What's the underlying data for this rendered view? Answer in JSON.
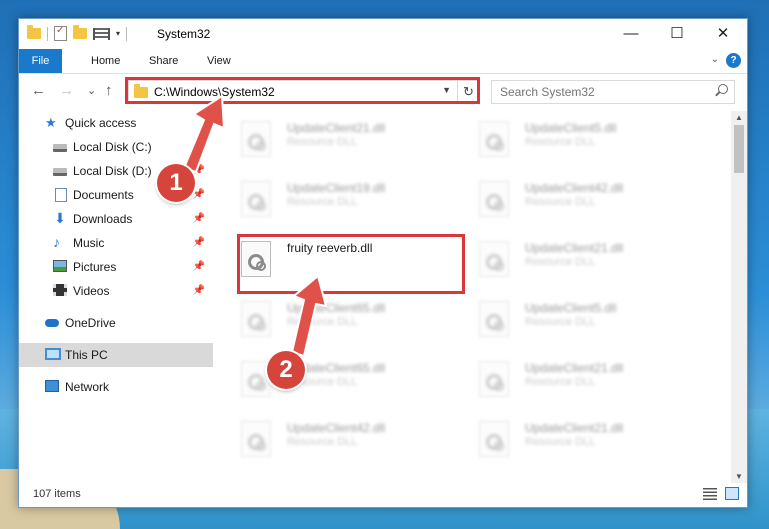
{
  "window": {
    "title": "System32",
    "controls": {
      "minimize": "—",
      "maximize": "☐",
      "close": "✕"
    }
  },
  "ribbon": {
    "tabs": [
      "File",
      "Home",
      "Share",
      "View"
    ],
    "help": "?"
  },
  "address_bar": {
    "path": "C:\\Windows\\System32",
    "refresh": "↻"
  },
  "search": {
    "placeholder": "Search System32"
  },
  "nav": {
    "back": "←",
    "forward": "→",
    "recent": "⌄",
    "up": "↑"
  },
  "sidebar": {
    "items": [
      {
        "label": "Quick access",
        "icon": "star-icon",
        "pinned": false
      },
      {
        "label": "Local Disk (C:)",
        "icon": "drive-icon",
        "pinned": true
      },
      {
        "label": "Local Disk (D:)",
        "icon": "drive-icon",
        "pinned": true
      },
      {
        "label": "Documents",
        "icon": "documents-icon",
        "pinned": true
      },
      {
        "label": "Downloads",
        "icon": "downloads-icon",
        "pinned": true
      },
      {
        "label": "Music",
        "icon": "music-icon",
        "pinned": true
      },
      {
        "label": "Pictures",
        "icon": "pictures-icon",
        "pinned": true
      },
      {
        "label": "Videos",
        "icon": "videos-icon",
        "pinned": true
      },
      {
        "label": "OneDrive",
        "icon": "onedrive-icon",
        "pinned": false
      },
      {
        "label": "This PC",
        "icon": "computer-icon",
        "pinned": false,
        "selected": true
      },
      {
        "label": "Network",
        "icon": "network-icon",
        "pinned": false
      }
    ],
    "pin_glyph": "📌"
  },
  "files": {
    "left_column": [
      {
        "name": "UpdateClient21.dll",
        "type": "Resource DLL",
        "blurred": true
      },
      {
        "name": "UpdateClient19.dll",
        "type": "Resource DLL",
        "blurred": true
      },
      {
        "name": "fruity reeverb.dll",
        "type": "",
        "blurred": false
      },
      {
        "name": "UpdateClient65.dll",
        "type": "Resource DLL",
        "blurred": true
      },
      {
        "name": "UpdateClient65.dll",
        "type": "Resource DLL",
        "blurred": true
      },
      {
        "name": "UpdateClient42.dll",
        "type": "Resource DLL",
        "blurred": true
      }
    ],
    "right_column": [
      {
        "name": "UpdateClient5.dll",
        "type": "Resource DLL",
        "blurred": true
      },
      {
        "name": "UpdateClient42.dll",
        "type": "Resource DLL",
        "blurred": true
      },
      {
        "name": "UpdateClient21.dll",
        "type": "Resource DLL",
        "blurred": true
      },
      {
        "name": "UpdateClient5.dll",
        "type": "Resource DLL",
        "blurred": true
      },
      {
        "name": "UpdateClient21.dll",
        "type": "Resource DLL",
        "blurred": true
      },
      {
        "name": "UpdateClient21.dll",
        "type": "Resource DLL",
        "blurred": true
      }
    ]
  },
  "status": {
    "item_count": "107 items"
  },
  "annotations": {
    "step1": "1",
    "step2": "2",
    "highlight_color": "#d9383a",
    "arrow_color": "#e0514a"
  }
}
